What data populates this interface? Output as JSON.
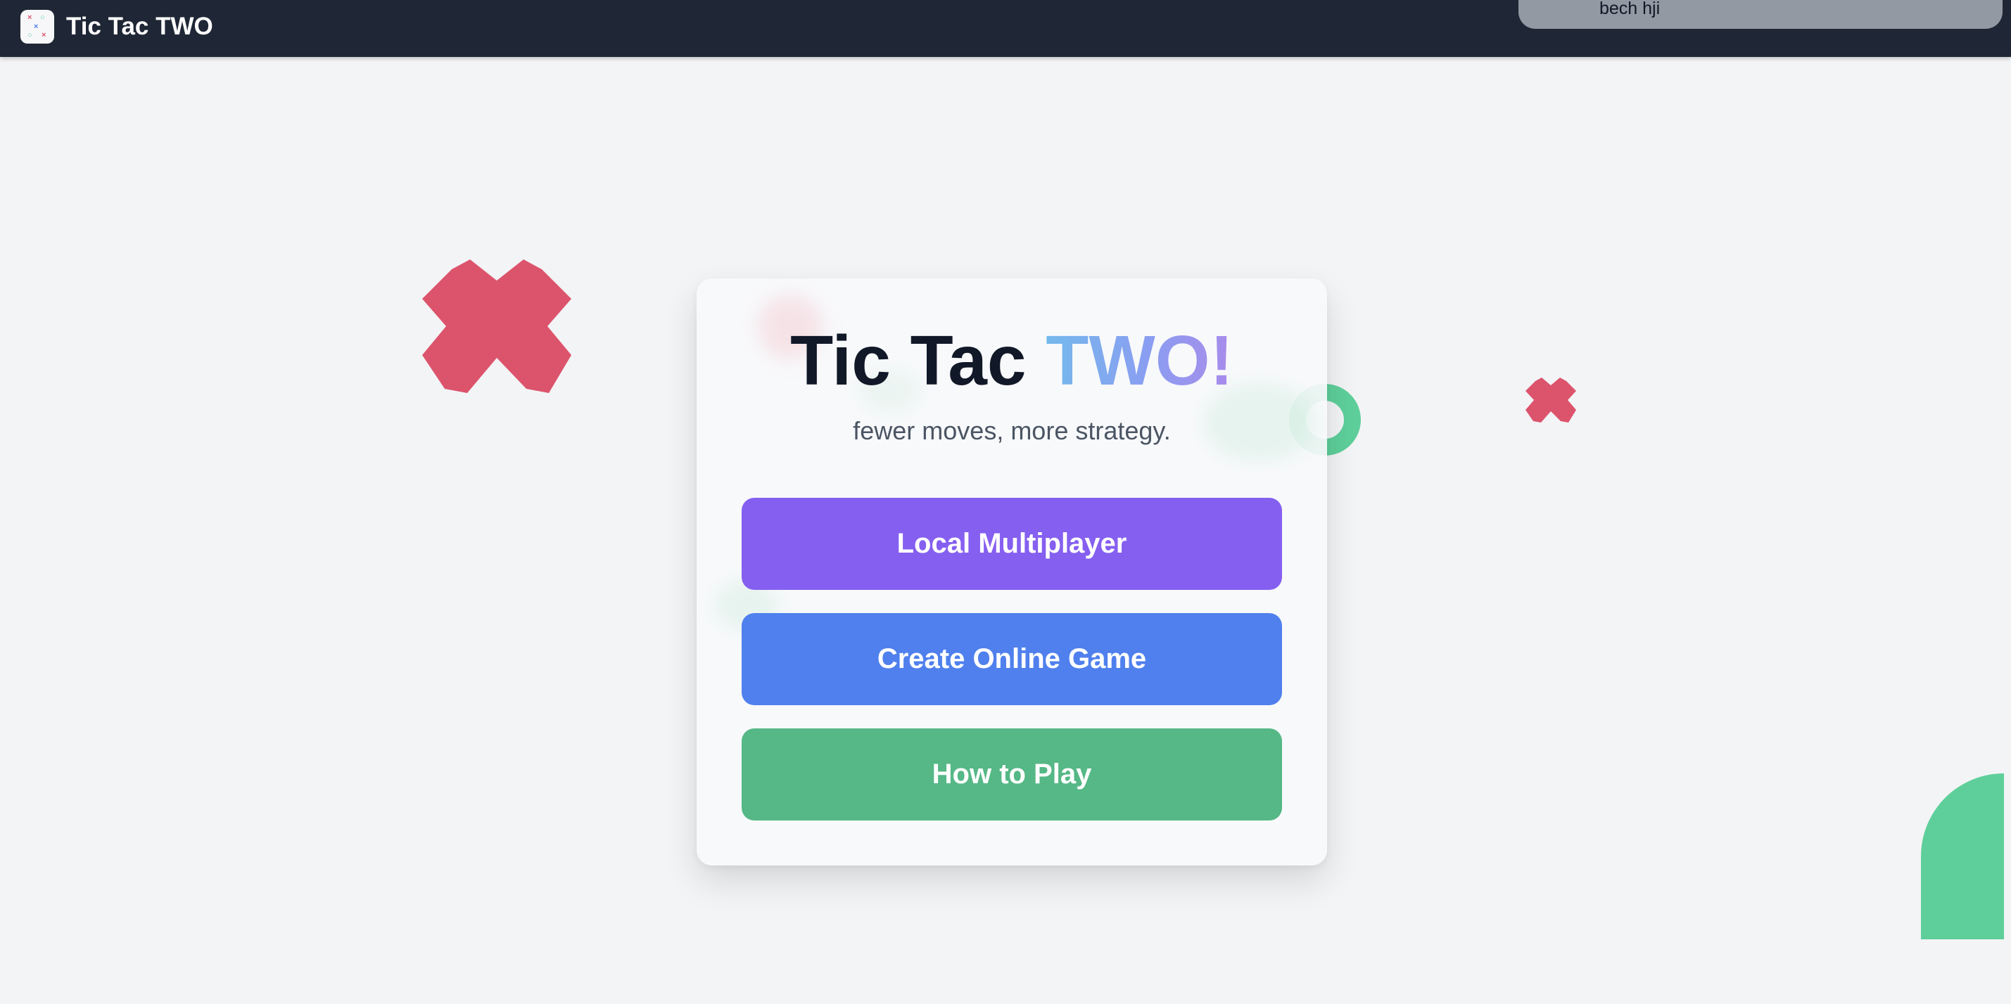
{
  "navbar": {
    "brand_title": "Tic Tac TWO",
    "user_name": "bech hji"
  },
  "card": {
    "title_main": "Tic Tac",
    "title_accent": "TWO!",
    "tagline": "fewer moves, more strategy."
  },
  "menu": {
    "local_label": "Local Multiplayer",
    "online_label": "Create Online Game",
    "howto_label": "How to Play"
  },
  "colors": {
    "navbar": "#1f2736",
    "background": "#f3f4f6",
    "local_button": "#855ff0",
    "online_button": "#4f80ed",
    "howto_button": "#55b886",
    "x_piece": "#dc546c",
    "o_piece": "#5ecf9a"
  },
  "icons": {
    "brand_logo": "tic-tac-toe-board-icon",
    "decorations": [
      "x-mark-icon",
      "o-ring-icon",
      "o-quarter-icon"
    ]
  }
}
